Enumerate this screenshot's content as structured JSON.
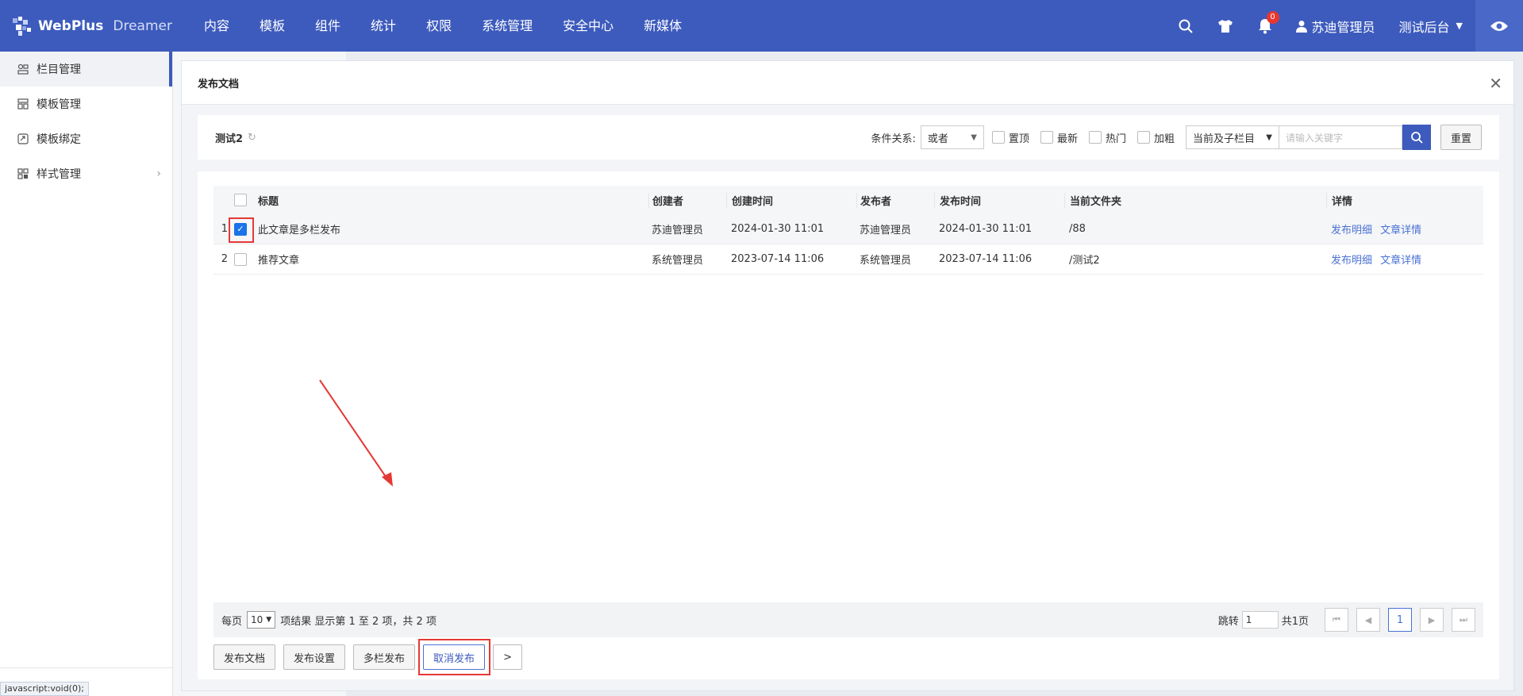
{
  "brand": {
    "name_a": "WebPlus",
    "name_b": "Dreamer"
  },
  "nav": [
    "内容",
    "模板",
    "组件",
    "统计",
    "权限",
    "系统管理",
    "安全中心",
    "新媒体"
  ],
  "topright": {
    "notifications": "0",
    "user": "苏迪管理员",
    "site": "测试后台"
  },
  "sidebar": {
    "items": [
      {
        "label": "栏目管理",
        "icon": "column-icon"
      },
      {
        "label": "模板管理",
        "icon": "template-icon"
      },
      {
        "label": "模板绑定",
        "icon": "binding-icon"
      },
      {
        "label": "样式管理",
        "icon": "style-icon"
      }
    ]
  },
  "statusbar": "javascript:void(0);",
  "dialog": {
    "title": "发布文档",
    "crumb": "测试2",
    "filters": {
      "relation_label": "条件关系:",
      "relation_value": "或者",
      "options": [
        "置顶",
        "最新",
        "热门",
        "加粗"
      ],
      "scope_value": "当前及子栏目",
      "search_placeholder": "请输入关键字",
      "reset": "重置"
    },
    "table": {
      "headers": [
        "标题",
        "创建者",
        "创建时间",
        "发布者",
        "发布时间",
        "当前文件夹",
        "详情"
      ],
      "rows": [
        {
          "num": "1",
          "checked": true,
          "title": "此文章是多栏发布",
          "creator": "苏迪管理员",
          "ctime": "2024-01-30 11:01",
          "publisher": "苏迪管理员",
          "ptime": "2024-01-30 11:01",
          "folder": "/88",
          "link1": "发布明细",
          "link2": "文章详情"
        },
        {
          "num": "2",
          "checked": false,
          "title": "推荐文章",
          "creator": "系统管理员",
          "ctime": "2023-07-14 11:06",
          "publisher": "系统管理员",
          "ptime": "2023-07-14 11:06",
          "folder": "/测试2",
          "link1": "发布明细",
          "link2": "文章详情"
        }
      ]
    },
    "pager": {
      "per_page_label": "每页",
      "per_page_value": "10",
      "summary": "项结果 显示第 1 至 2 项，共 2 项",
      "jump_label": "跳转",
      "jump_value": "1",
      "total_pages": "共1页",
      "current_page": "1",
      "first": "⏮",
      "prev": "◀",
      "next": "▶",
      "last": "⏭"
    },
    "actions": [
      "发布文档",
      "发布设置",
      "多栏发布",
      "取消发布",
      ">"
    ]
  }
}
